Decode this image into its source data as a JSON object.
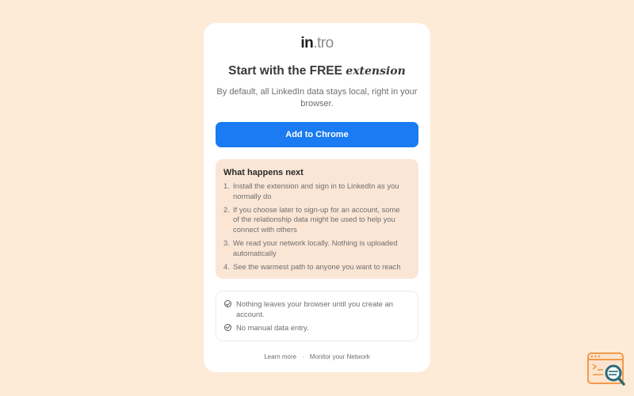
{
  "logo": {
    "part1": "in",
    "part2": ".tro"
  },
  "headline": {
    "main": "Start with the FREE",
    "emphasis": "extension"
  },
  "subtitle": "By default, all LinkedIn data stays local, right in your browser.",
  "cta": {
    "label": "Add to Chrome",
    "color": "#1a7bf2"
  },
  "next": {
    "title": "What happens next",
    "steps": [
      {
        "num": "1.",
        "text": "Install the extension and sign in to LinkedIn as you normally do"
      },
      {
        "num": "2.",
        "text": "If you choose later to sign-up for an account, some of the relationship data might be used to help you connect with others"
      },
      {
        "num": "3.",
        "text": "We read your network locally. Nothing is uploaded automatically"
      },
      {
        "num": "4.",
        "text": "See the warmest path to anyone you want to reach"
      }
    ]
  },
  "assurances": [
    {
      "icon": "check-circle-icon",
      "text": "Nothing leaves your browser until you create an account."
    },
    {
      "icon": "check-circle-icon",
      "text": "No manual data entry."
    }
  ],
  "footer": {
    "learn_more": "Learn more",
    "separator": "·",
    "monitor": "Monitor your Network"
  },
  "widget": {
    "icon": "search-inspect-icon",
    "color": "#f29a4a"
  }
}
